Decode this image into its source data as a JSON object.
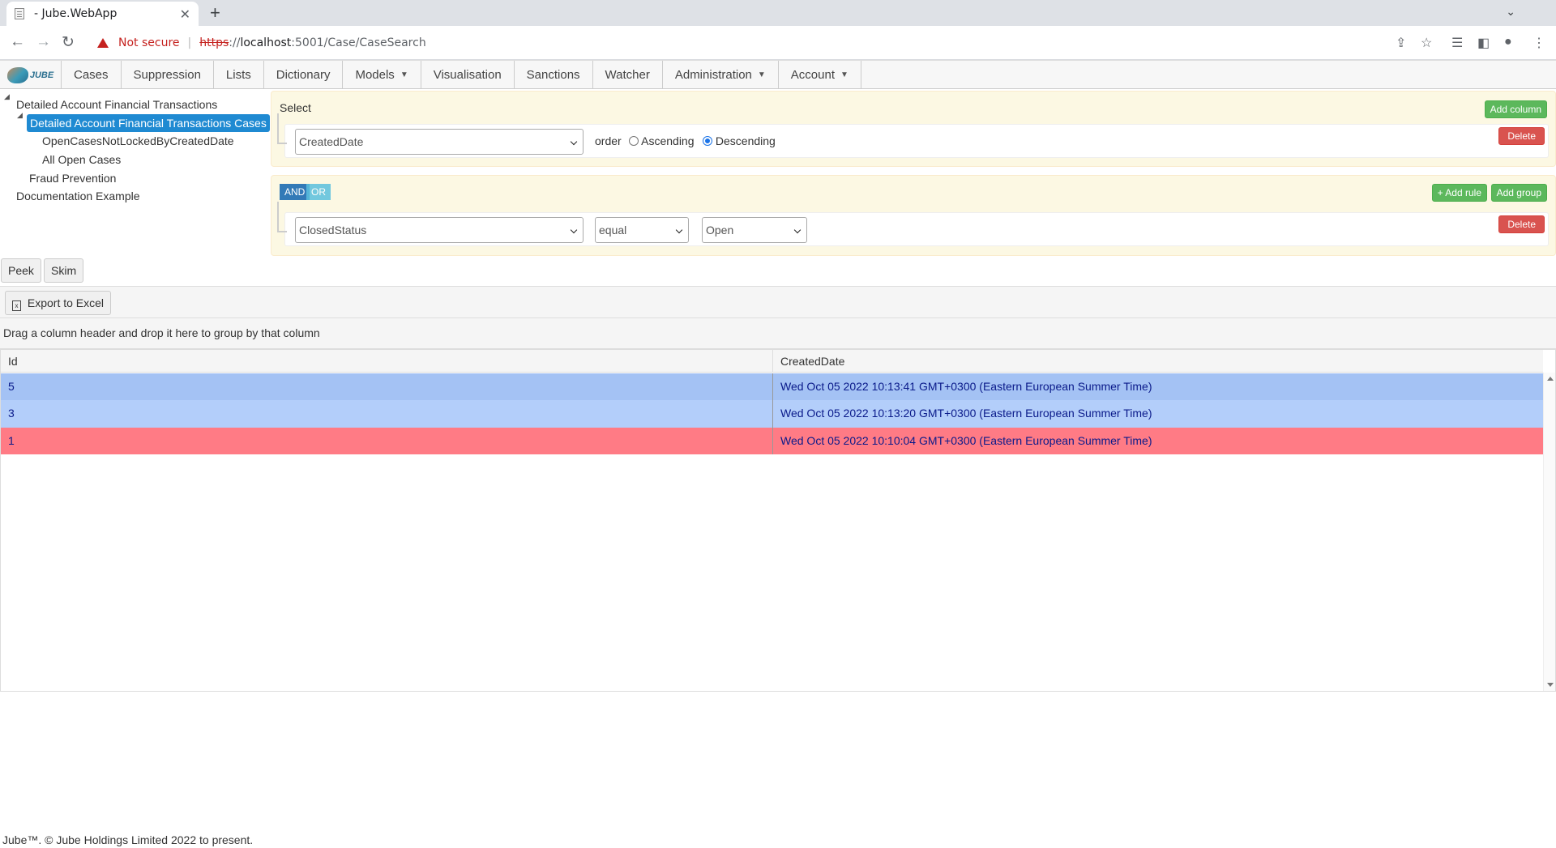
{
  "browser": {
    "tab_title": "- Jube.WebApp",
    "tab_close": "✕",
    "new_tab": "+",
    "tab_menu": "⌄",
    "minimize": "—",
    "maximize": "☐",
    "close": "✕",
    "not_secure": "Not secure",
    "url_scheme": "https",
    "url_sep": "://",
    "url_host": "localhost",
    "url_path": ":5001/Case/CaseSearch"
  },
  "menu": {
    "logo_text": "JUBE",
    "items": [
      "Cases",
      "Suppression",
      "Lists",
      "Dictionary",
      "Models",
      "Visualisation",
      "Sanctions",
      "Watcher",
      "Administration",
      "Account"
    ]
  },
  "tree": {
    "root": "Detailed Account Financial Transactions",
    "selected": "Detailed Account Financial Transactions Cases",
    "child1": "OpenCasesNotLockedByCreatedDate",
    "child2": "All Open Cases",
    "fraud": "Fraud Prevention",
    "doc": "Documentation Example"
  },
  "select_panel": {
    "label": "Select",
    "add_column": "Add column",
    "field": "CreatedDate",
    "order_label": "order",
    "ascending": "Ascending",
    "descending": "Descending",
    "order_selected": "Descending",
    "delete": "Delete"
  },
  "filter_panel": {
    "and": "AND",
    "or": "OR",
    "active_condition": "AND",
    "add_rule": "+ Add rule",
    "add_group": "Add group",
    "field": "ClosedStatus",
    "operator": "equal",
    "value": "Open",
    "delete": "Delete"
  },
  "actions": {
    "peek": "Peek",
    "skim": "Skim",
    "export": "Export to Excel",
    "export_icon": "x"
  },
  "grid": {
    "group_hint": "Drag a column header and drop it here to group by that column",
    "columns": [
      "Id",
      "CreatedDate"
    ],
    "rows": [
      {
        "id": "5",
        "created": "Wed Oct 05 2022 10:13:41 GMT+0300 (Eastern European Summer Time)",
        "color": "#a4c2f4"
      },
      {
        "id": "3",
        "created": "Wed Oct 05 2022 10:13:20 GMT+0300 (Eastern European Summer Time)",
        "color": "#b3cefa"
      },
      {
        "id": "1",
        "created": "Wed Oct 05 2022 10:10:04 GMT+0300 (Eastern European Summer Time)",
        "color": "#ff7b85"
      }
    ]
  },
  "footer": "Jube™. © Jube Holdings Limited 2022 to present."
}
